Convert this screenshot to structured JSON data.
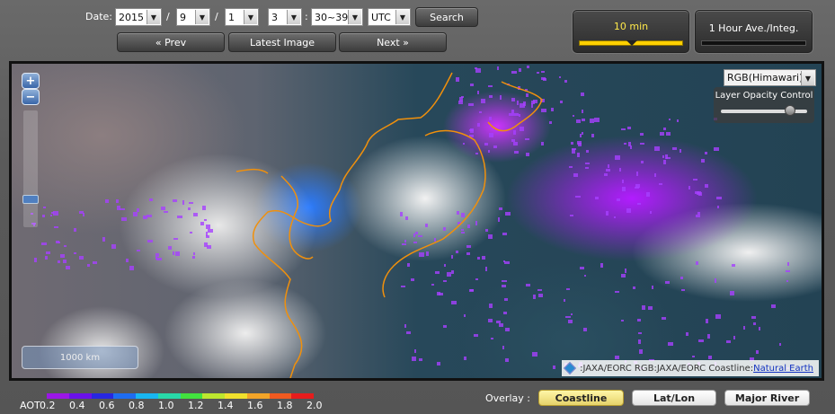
{
  "date_form": {
    "date_label": "Date:",
    "year": "2015",
    "sep1": "/",
    "month": "9",
    "sep2": "/",
    "day": "1",
    "hour": "3",
    "colon": ":",
    "minute": "30~39",
    "timezone": "UTC",
    "search_label": "Search"
  },
  "nav": {
    "prev_label": "« Prev",
    "latest_label": "Latest Image",
    "next_label": "Next »"
  },
  "interval": {
    "ten_min_label": "10 min",
    "hour_label": "1 Hour Ave./Integ."
  },
  "map": {
    "layer_select": "RGB(Himawari)",
    "opacity_label": "Layer Opacity Control",
    "opacity_value": 0.85,
    "zoom_in": "+",
    "zoom_out": "−",
    "scale_label": "1000 km",
    "attribution_text": ":JAXA/EORC RGB:JAXA/EORC Coastline:",
    "attribution_link": "Natural Earth"
  },
  "legend": {
    "title": "AOT",
    "ticks": [
      "0.2",
      "0.4",
      "0.6",
      "0.8",
      "1.0",
      "1.2",
      "1.4",
      "1.6",
      "1.8",
      "2.0"
    ],
    "colors": [
      "#9b16e6",
      "#6a10e8",
      "#2727e0",
      "#1e6cf0",
      "#18b6f0",
      "#28d8a8",
      "#42e23e",
      "#bde62e",
      "#f0e02c",
      "#f2a428",
      "#f05a20",
      "#e61c1c"
    ]
  },
  "overlay": {
    "label": "Overlay :",
    "coastline_label": "Coastline",
    "latlon_label": "Lat/Lon",
    "river_label": "Major River",
    "active": "Coastline"
  }
}
